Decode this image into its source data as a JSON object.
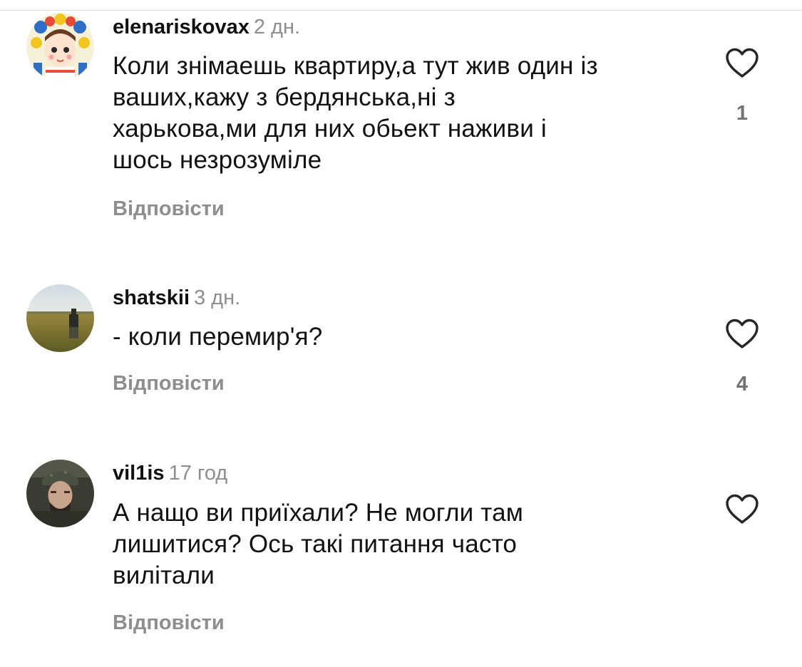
{
  "comments": [
    {
      "username": "elenariskovax",
      "time": "2 дн.",
      "text_lines": [
        "Коли знімаешь квартиру,а тут жив один із",
        "ваших,кажу з бердянська,ні з",
        "харькова,ми для них обьект наживи і",
        "шось незрозуміле"
      ],
      "reply_label": "Відповісти",
      "likes": "1",
      "avatar_icon": "avatar-illustration-girl-wreath"
    },
    {
      "username": "shatskii",
      "time": "3 дн.",
      "text_lines": [
        "- коли перемир'я?"
      ],
      "reply_label": "Відповісти",
      "likes": "4",
      "avatar_icon": "avatar-photo-wheat-field"
    },
    {
      "username": "vil1is",
      "time": "17 год",
      "text_lines": [
        "А нащо ви приїхали? Не могли там",
        "лишитися? Ось такі питання часто",
        "вилітали"
      ],
      "reply_label": "Відповісти",
      "likes": "",
      "avatar_icon": "avatar-photo-man-helmet"
    }
  ],
  "heart_icon": "heart-outline-icon",
  "colors": {
    "text": "#111111",
    "secondary": "#8e8e8e",
    "divider": "#dbdbdb"
  }
}
